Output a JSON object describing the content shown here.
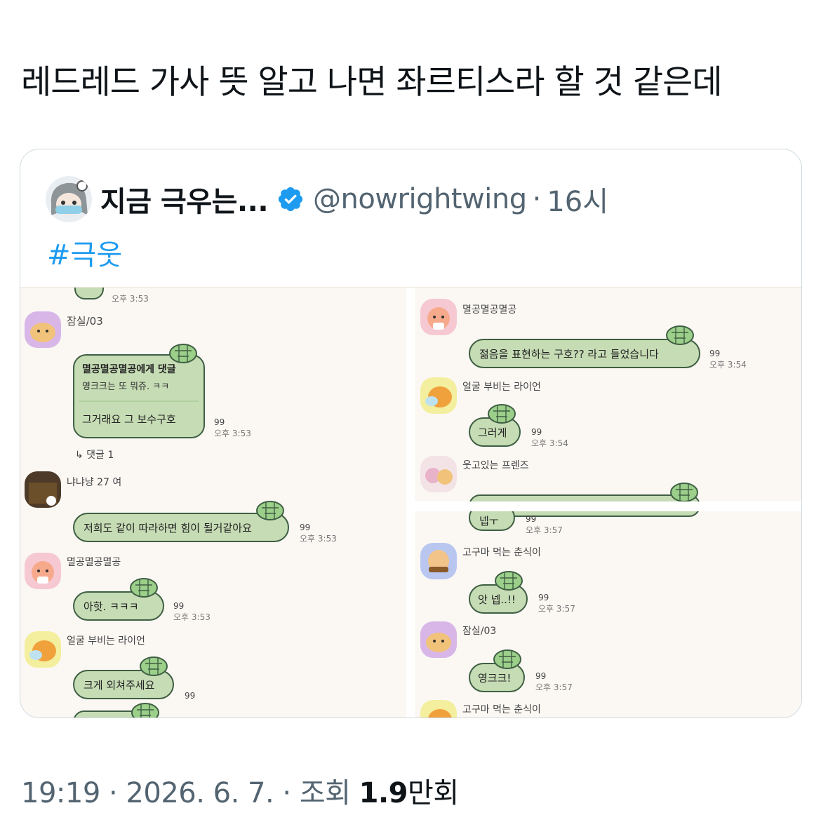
{
  "tweet": {
    "text": "레드레드 가사 뜻 알고 나면 좌르티스라 할 것 같은데",
    "timestamp": "19:19 · 2026. 6. 7. · 조회",
    "views_count": "1.9",
    "views_unit": "만회"
  },
  "quote": {
    "display_name": "지금 극우는...",
    "handle": "@nowrightwing",
    "separator": "·",
    "time": "16시",
    "hashtag": "#극웃",
    "verified_color": "#1d9bf0"
  },
  "chat_left": {
    "top_time": "오후 3:53",
    "msg1_user": "잠실/03",
    "msg1_reply_to": "멸공멸공멸공에게 댓글",
    "msg1_quote": "영크크는 또 뭐쥬. ㅋㅋ",
    "msg1_text": "그거래요 그 보수구호",
    "msg1_count": "99",
    "msg1_time": "오후 3:53",
    "msg1_replies": "↳ 댓글 1",
    "msg2_user": "냐냐냥 27 여",
    "msg2_text": "저희도 같이 따라하면 힘이 될거같아요",
    "msg2_count": "99",
    "msg2_time": "오후 3:53",
    "msg3_user": "멸공멸공멸공",
    "msg3_text": "아핫. ㅋㅋㅋ",
    "msg3_count": "99",
    "msg3_time": "오후 3:53",
    "msg4_user": "얼굴 부비는 라이언",
    "msg4_text": "크게 외쳐주세요",
    "msg4_count": "99"
  },
  "chat_right_top": {
    "msg1_user": "멸공멸공멸공",
    "msg1_text": "젊음을 표현하는 구호?? 라고 들었습니다",
    "msg1_count": "99",
    "msg1_time": "오후 3:54",
    "msg2_user": "얼굴 부비는 라이언",
    "msg2_text": "그러게",
    "msg2_count": "99",
    "msg2_time": "오후 3:54",
    "msg3_user": "웃고있는 프렌즈"
  },
  "chat_right_bottom": {
    "msg0_text": "넵ㅜ",
    "msg0_count": "99",
    "msg0_time": "오후 3:57",
    "msg1_user": "고구마 먹는 춘식이",
    "msg1_text": "앗 넵..!!",
    "msg1_count": "99",
    "msg1_time": "오후 3:57",
    "msg2_user": "잠실/03",
    "msg2_text": "영크크!",
    "msg2_count": "99",
    "msg2_time": "오후 3:57",
    "msg3_user": "고구마 먹는 춘식이"
  },
  "colors": {
    "bubble_fill": "#c6dcb5",
    "bubble_stroke": "#3f5f43",
    "chat_bg": "#fbf8f4",
    "link": "#1d9bf0",
    "muted": "#536471"
  }
}
